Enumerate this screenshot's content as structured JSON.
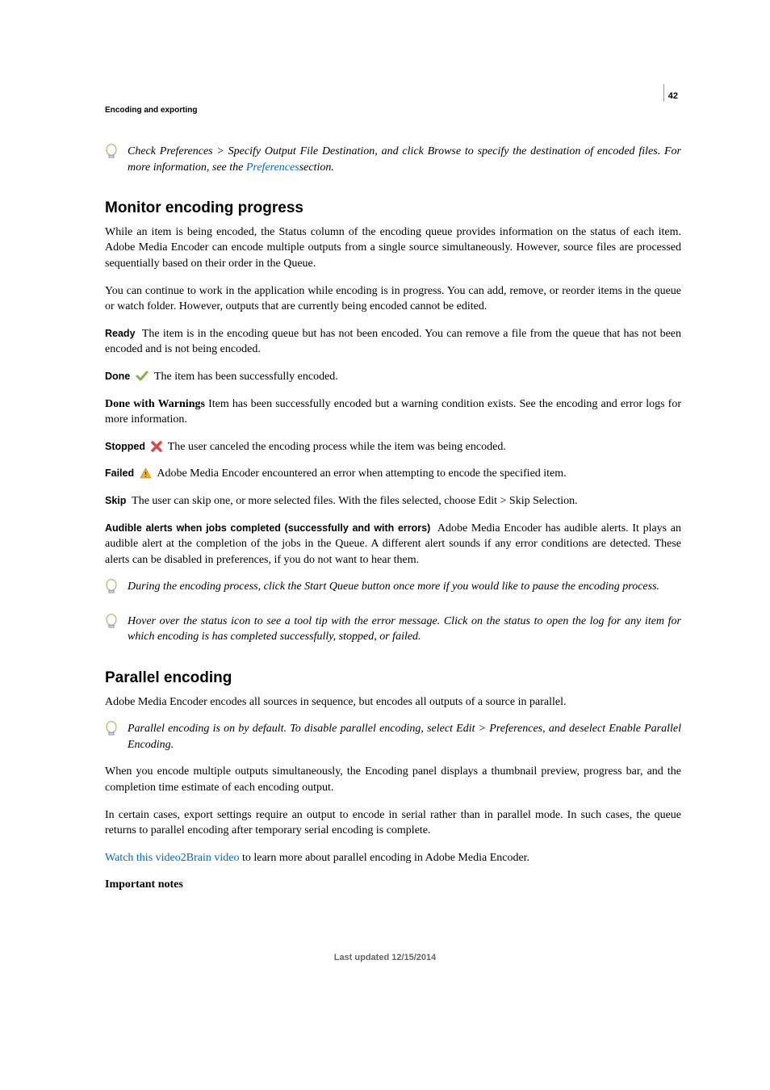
{
  "page_number": "42",
  "running_head": "Encoding and exporting",
  "tip_top": {
    "text_before_link": "Check Preferences > Specify Output File Destination, and click Browse to specify the destination of encoded files. For more information, see the ",
    "link_text": "Preferences",
    "text_after_link": "section."
  },
  "monitor": {
    "heading": "Monitor encoding progress",
    "para1": "While an item is being encoded, the Status column of the encoding queue provides information on the status of each item. Adobe Media Encoder can encode multiple outputs from a single source simultaneously. However, source files are processed sequentially based on their order in the Queue.",
    "para2": "You can continue to work in the application while encoding is in progress. You can add, remove, or reorder items in the queue or watch folder. However, outputs that are currently being encoded cannot be edited.",
    "ready": {
      "term": "Ready",
      "desc": "The item is in the encoding queue but has not been encoded. You can remove a file from the queue that has not been encoded and is not being encoded."
    },
    "done": {
      "term": "Done",
      "desc": "The item has been successfully encoded."
    },
    "done_warn": {
      "term": "Done with Warnings",
      "desc": "Item has been successfully encoded but a warning condition exists. See the encoding and error logs for more information."
    },
    "stopped": {
      "term": "Stopped",
      "desc": "The user canceled the encoding process while the item was being encoded."
    },
    "failed": {
      "term": "Failed",
      "desc": "Adobe Media Encoder encountered an error when attempting to encode the specified item."
    },
    "skip": {
      "term": "Skip",
      "desc": "The user can skip one, or more selected files. With the files selected, choose Edit > Skip Selection."
    },
    "audible": {
      "term": "Audible alerts when jobs completed (successfully and with errors)",
      "desc": "Adobe Media Encoder has audible alerts. It plays an audible alert at the completion of the jobs in the Queue. A different alert sounds if any error conditions are detected. These alerts can be disabled in preferences, if you do not want to hear them."
    },
    "tip_pause": "During the encoding process, click the Start Queue button once more if you would like to pause the encoding process.",
    "tip_hover": "Hover over the status icon to see a tool tip with the error message. Click on the status to open the log for any item for which encoding is has completed successfully, stopped, or failed."
  },
  "parallel": {
    "heading": "Parallel encoding",
    "para1": "Adobe Media Encoder encodes all sources in sequence, but encodes all outputs of a source in parallel.",
    "tip": " Parallel encoding is on by default. To disable parallel encoding, select Edit > Preferences, and deselect Enable Parallel Encoding.",
    "para2": "When you encode multiple outputs simultaneously, the Encoding panel displays a thumbnail preview, progress bar, and the completion time estimate of each encoding output.",
    "para3": "In certain cases, export settings require an output to encode in serial rather than in parallel mode. In such cases, the queue returns to parallel encoding after temporary serial encoding is complete.",
    "link_text": "Watch this video2Brain video",
    "link_after": " to learn more about parallel encoding in Adobe Media Encoder.",
    "notes_label": "Important notes"
  },
  "footer": "Last updated 12/15/2014"
}
